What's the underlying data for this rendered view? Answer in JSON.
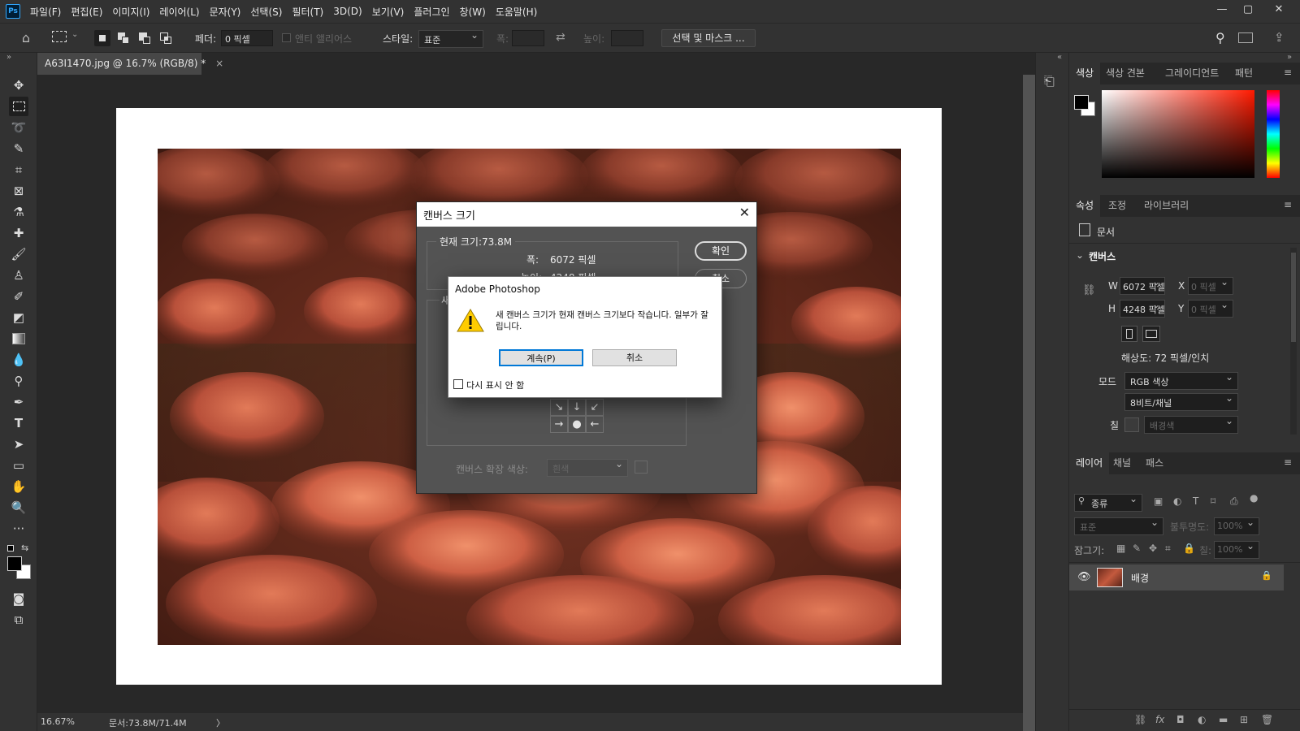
{
  "menubar": {
    "logo": "Ps",
    "items": [
      "파일(F)",
      "편집(E)",
      "이미지(I)",
      "레이어(L)",
      "문자(Y)",
      "선택(S)",
      "필터(T)",
      "3D(D)",
      "보기(V)",
      "플러그인",
      "창(W)",
      "도움말(H)"
    ],
    "window_controls": [
      "minimize-icon",
      "maximize-icon",
      "close-icon"
    ]
  },
  "options": {
    "feather_label": "페더:",
    "feather_value": "0 픽셀",
    "antialias_label": "앤티 앨리어스",
    "style_label": "스타일:",
    "style_value": "표준",
    "width_label": "폭:",
    "height_label": "높이:",
    "select_mask_label": "선택 및 마스크 ..."
  },
  "document": {
    "tab_title": "A63I1470.jpg @ 16.7% (RGB/8) *",
    "zoom": "16.67%",
    "doc_info": "문서:73.8M/71.4M",
    "arrow": "〉"
  },
  "color_panel": {
    "tabs": [
      "색상",
      "색상 견본",
      "그레이디언트",
      "패턴"
    ],
    "active_tab": "색상",
    "foreground": "#000000",
    "background": "#ffffff",
    "hue_base": "#ff1a00"
  },
  "properties_panel": {
    "tabs": [
      "속성",
      "조정",
      "라이브러리"
    ],
    "doc_label": "문서",
    "section_title": "캔버스",
    "w_label": "W",
    "w_value": "6072 픽셀",
    "h_label": "H",
    "h_value": "4248 픽셀",
    "x_label": "X",
    "x_value": "0 픽셀",
    "y_label": "Y",
    "y_value": "0 픽셀",
    "resolution": "해상도: 72 픽셀/인치",
    "mode_label": "모드",
    "mode_value": "RGB 색상",
    "depth_value": "8비트/채널",
    "fill_label": "칠",
    "fill_value": "배경색"
  },
  "layers_panel": {
    "tabs": [
      "레이어",
      "채널",
      "패스"
    ],
    "filter_label": "종류",
    "blend_mode": "표준",
    "opacity_label": "불투명도:",
    "opacity_value": "100%",
    "lock_label": "잠그기:",
    "fill_label": "칠:",
    "fill_value": "100%",
    "layers": [
      {
        "name": "배경",
        "visible": true,
        "locked": true
      }
    ]
  },
  "canvas_dialog": {
    "title": "캔버스 크기",
    "current_size_label": "현재 크기:73.8M",
    "width_label": "폭:",
    "width_value": "6072 픽셀",
    "height_label_partial": "높이:",
    "height_value_partial": "4248 픽셀",
    "new_size_partial": "새",
    "ok_button": "확인",
    "cancel_button_partial": "취소",
    "extension_color_label": "캔버스 확장 색상:",
    "extension_color_value": "흰색",
    "anchor_arrows": [
      "↘",
      "↓",
      "↙",
      "→",
      "●",
      "←"
    ]
  },
  "alert_dialog": {
    "title": "Adobe Photoshop",
    "message": "새 캔버스 크기가 현재 캔버스 크기보다 작습니다. 일부가 잘립니다.",
    "continue_button": "계속(P)",
    "cancel_button": "취소",
    "dont_show_label": "다시 표시 안 함",
    "dont_show_checked": false
  }
}
